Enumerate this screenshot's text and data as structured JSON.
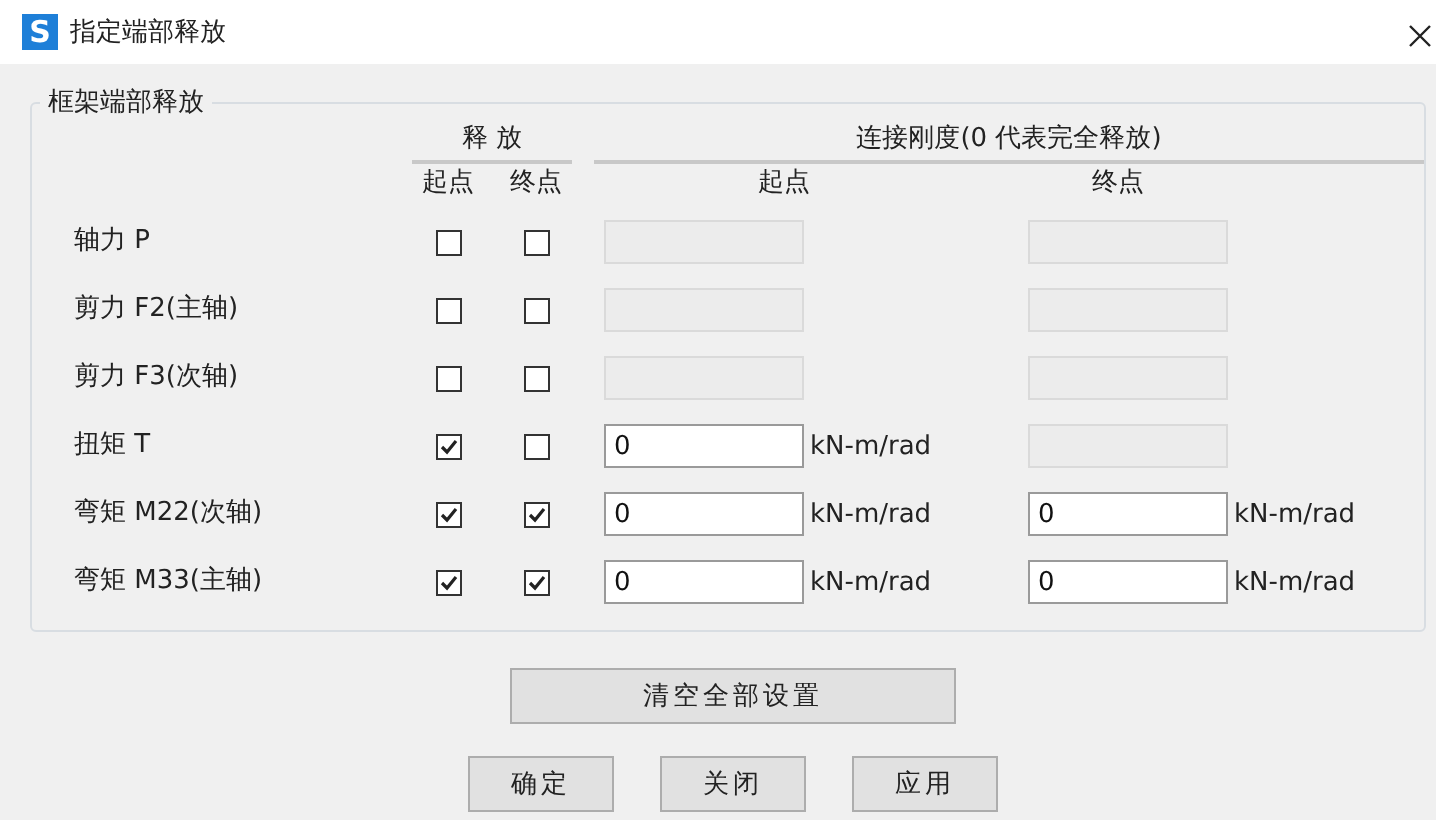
{
  "window": {
    "title": "指定端部释放",
    "logo_letter": "S"
  },
  "group": {
    "title": "框架端部释放",
    "release_header": "释 放",
    "stiffness_header": "连接刚度(0 代表完全释放)",
    "sub_headers": [
      "起点",
      "终点",
      "起点",
      "终点"
    ],
    "rows": [
      {
        "label": "轴力 P",
        "start_release": {
          "checked": false
        },
        "end_release": {
          "checked": false
        },
        "start_stiffness": {
          "disabled": true
        },
        "end_stiffness": {
          "disabled": true
        }
      },
      {
        "label": "剪力 F2(主轴)",
        "start_release": {
          "checked": false
        },
        "end_release": {
          "checked": false
        },
        "start_stiffness": {
          "disabled": true
        },
        "end_stiffness": {
          "disabled": true
        }
      },
      {
        "label": "剪力 F3(次轴)",
        "start_release": {
          "checked": false
        },
        "end_release": {
          "checked": false
        },
        "start_stiffness": {
          "disabled": true
        },
        "end_stiffness": {
          "disabled": true
        }
      },
      {
        "label": "扭矩 T",
        "start_release": {
          "checked": true
        },
        "end_release": {
          "checked": false
        },
        "start_stiffness": {
          "value": "0",
          "unit": "kN-m/rad",
          "disabled": false
        },
        "end_stiffness": {
          "disabled": true
        }
      },
      {
        "label": "弯矩 M22(次轴)",
        "start_release": {
          "checked": true
        },
        "end_release": {
          "checked": true
        },
        "start_stiffness": {
          "value": "0",
          "unit": "kN-m/rad",
          "disabled": false
        },
        "end_stiffness": {
          "value": "0",
          "unit": "kN-m/rad",
          "disabled": false
        }
      },
      {
        "label": "弯矩 M33(主轴)",
        "start_release": {
          "checked": true
        },
        "end_release": {
          "checked": true
        },
        "start_stiffness": {
          "value": "0",
          "unit": "kN-m/rad",
          "disabled": false
        },
        "end_stiffness": {
          "value": "0",
          "unit": "kN-m/rad",
          "disabled": false
        }
      }
    ]
  },
  "clear_button": "清空全部设置",
  "buttons": [
    "确定",
    "关闭",
    "应用"
  ]
}
